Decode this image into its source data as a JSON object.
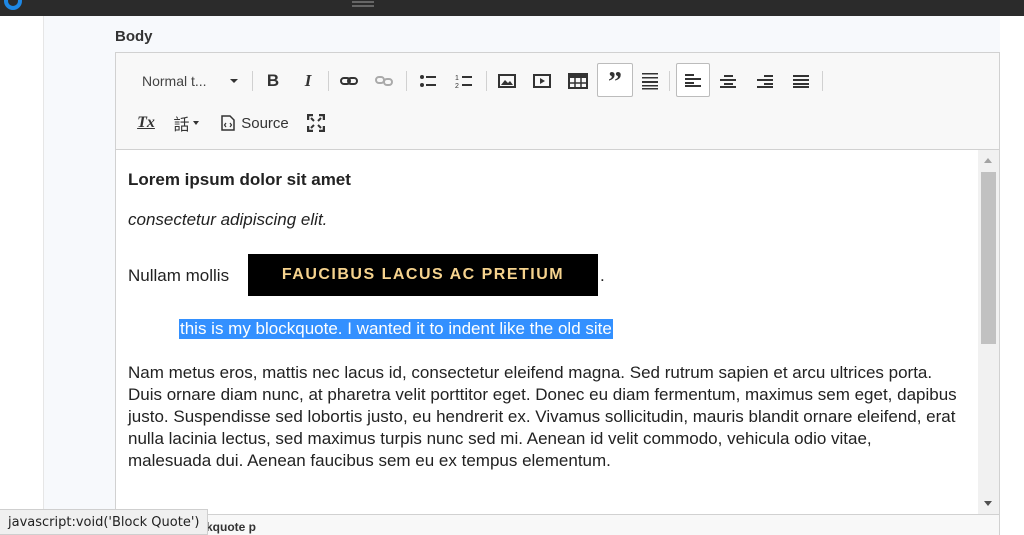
{
  "field": {
    "label": "Body"
  },
  "toolbar": {
    "format_combo": "Normal t...",
    "bold": "B",
    "italic": "I",
    "link_icon": "link-icon",
    "unlink_icon": "unlink-icon",
    "bulleted_list_icon": "bulleted-list-icon",
    "numbered_list_icon": "numbered-list-icon",
    "image_icon": "image-icon",
    "media_icon": "media-icon",
    "table_icon": "table-icon",
    "blockquote": "”",
    "hr_icon": "horizontal-line-icon",
    "align_left_icon": "align-left-icon",
    "align_center_icon": "align-center-icon",
    "align_right_icon": "align-right-icon",
    "justify_icon": "justify-icon",
    "remove_format": "Tx",
    "language": "話",
    "source": "Source",
    "maximize_icon": "maximize-icon"
  },
  "content": {
    "heading": "Lorem ipsum dolor sit amet",
    "italic_line": "consectetur adipiscing elit.",
    "line3_text": "Nullam mollis",
    "badge": "FAUCIBUS LACUS AC PRETIUM",
    "line3_end": ".",
    "blockquote": "this is my blockquote. I wanted it to indent like the old site",
    "paragraph": "Nam metus eros, mattis nec lacus id, consectetur eleifend magna. Sed rutrum sapien et arcu ultrices porta. Duis ornare diam nunc, at pharetra velit porttitor eget. Donec eu diam fermentum, maximus sem eget, dapibus justo. Suspendisse sed lobortis justo, eu hendrerit ex. Vivamus sollicitudin, mauris blandit ornare eleifend, erat nulla lacinia lectus, sed maximus turpis nunc sed mi. Aenean id velit commodo, vehicula odio vitae, malesuada dui. Aenean faucibus sem eu ex tempus elementum."
  },
  "path_bar": {
    "text": "kquote   p"
  },
  "status_tip": "javascript:void('Block Quote')",
  "colors": {
    "selection": "#3390ff",
    "badge_bg": "#000000",
    "badge_text": "#f6d38e",
    "topbar": "#2b2b2b"
  }
}
